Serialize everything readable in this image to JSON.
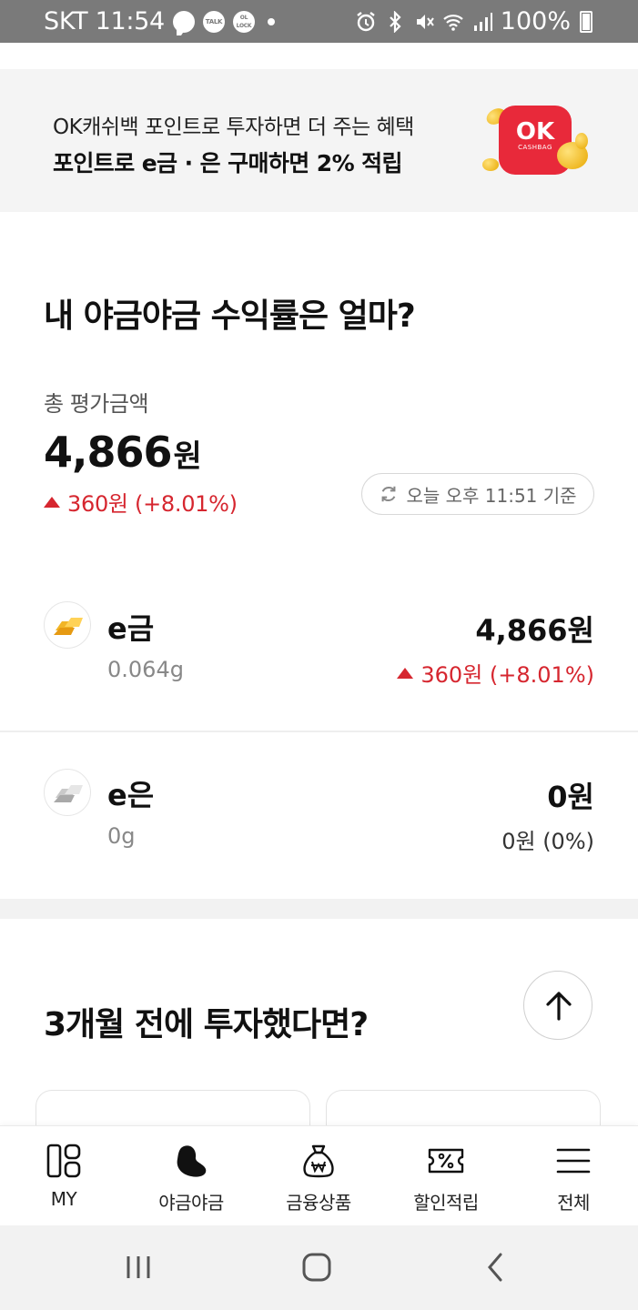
{
  "status_bar": {
    "carrier_time": "SKT 11:54",
    "talk_label": "TALK",
    "lock_label": "OL LOCK",
    "battery": "100%"
  },
  "promo": {
    "line1": "OK캐쉬백 포인트로 투자하면 더 주는 혜택",
    "line2": "포인트로 e금 · 은 구매하면 2% 적립",
    "badge_ok": "OK",
    "badge_sub": "CASHBAG"
  },
  "returns": {
    "title": "내 야금야금 수익률은 얼마?",
    "total_label": "총 평가금액",
    "total_amount": "4,866",
    "total_unit": "원",
    "total_change": "360원 (+8.01%)",
    "basis_time": "오늘 오후 11:51 기준"
  },
  "assets": [
    {
      "name": "e금",
      "qty": "0.064g",
      "amount": "4,866원",
      "change": "360원 (+8.01%)",
      "direction": "up",
      "icon": "gold-bar-icon"
    },
    {
      "name": "e은",
      "qty": "0g",
      "amount": "0원",
      "change": "0원 (0%)",
      "direction": "none",
      "icon": "silver-bar-icon"
    }
  ],
  "simulation": {
    "title": "3개월 전에 투자했다면?"
  },
  "bottom_nav": [
    {
      "label": "MY",
      "icon": "my-grid-icon"
    },
    {
      "label": "야금야금",
      "icon": "bean-icon"
    },
    {
      "label": "금융상품",
      "icon": "money-bag-icon"
    },
    {
      "label": "할인적립",
      "icon": "coupon-icon"
    },
    {
      "label": "전체",
      "icon": "menu-icon"
    }
  ],
  "colors": {
    "accent_red": "#d6262f",
    "ok_red": "#e8293a",
    "banner_bg": "#f4f4f4"
  }
}
